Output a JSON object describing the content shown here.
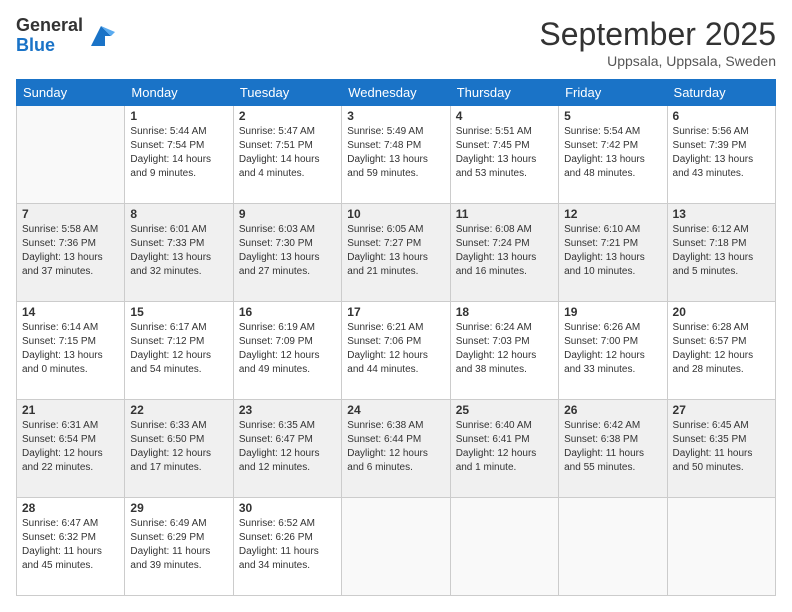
{
  "logo": {
    "general": "General",
    "blue": "Blue"
  },
  "title": "September 2025",
  "location": "Uppsala, Uppsala, Sweden",
  "weekdays": [
    "Sunday",
    "Monday",
    "Tuesday",
    "Wednesday",
    "Thursday",
    "Friday",
    "Saturday"
  ],
  "weeks": [
    [
      {
        "day": "",
        "info": ""
      },
      {
        "day": "1",
        "info": "Sunrise: 5:44 AM\nSunset: 7:54 PM\nDaylight: 14 hours\nand 9 minutes."
      },
      {
        "day": "2",
        "info": "Sunrise: 5:47 AM\nSunset: 7:51 PM\nDaylight: 14 hours\nand 4 minutes."
      },
      {
        "day": "3",
        "info": "Sunrise: 5:49 AM\nSunset: 7:48 PM\nDaylight: 13 hours\nand 59 minutes."
      },
      {
        "day": "4",
        "info": "Sunrise: 5:51 AM\nSunset: 7:45 PM\nDaylight: 13 hours\nand 53 minutes."
      },
      {
        "day": "5",
        "info": "Sunrise: 5:54 AM\nSunset: 7:42 PM\nDaylight: 13 hours\nand 48 minutes."
      },
      {
        "day": "6",
        "info": "Sunrise: 5:56 AM\nSunset: 7:39 PM\nDaylight: 13 hours\nand 43 minutes."
      }
    ],
    [
      {
        "day": "7",
        "info": "Sunrise: 5:58 AM\nSunset: 7:36 PM\nDaylight: 13 hours\nand 37 minutes."
      },
      {
        "day": "8",
        "info": "Sunrise: 6:01 AM\nSunset: 7:33 PM\nDaylight: 13 hours\nand 32 minutes."
      },
      {
        "day": "9",
        "info": "Sunrise: 6:03 AM\nSunset: 7:30 PM\nDaylight: 13 hours\nand 27 minutes."
      },
      {
        "day": "10",
        "info": "Sunrise: 6:05 AM\nSunset: 7:27 PM\nDaylight: 13 hours\nand 21 minutes."
      },
      {
        "day": "11",
        "info": "Sunrise: 6:08 AM\nSunset: 7:24 PM\nDaylight: 13 hours\nand 16 minutes."
      },
      {
        "day": "12",
        "info": "Sunrise: 6:10 AM\nSunset: 7:21 PM\nDaylight: 13 hours\nand 10 minutes."
      },
      {
        "day": "13",
        "info": "Sunrise: 6:12 AM\nSunset: 7:18 PM\nDaylight: 13 hours\nand 5 minutes."
      }
    ],
    [
      {
        "day": "14",
        "info": "Sunrise: 6:14 AM\nSunset: 7:15 PM\nDaylight: 13 hours\nand 0 minutes."
      },
      {
        "day": "15",
        "info": "Sunrise: 6:17 AM\nSunset: 7:12 PM\nDaylight: 12 hours\nand 54 minutes."
      },
      {
        "day": "16",
        "info": "Sunrise: 6:19 AM\nSunset: 7:09 PM\nDaylight: 12 hours\nand 49 minutes."
      },
      {
        "day": "17",
        "info": "Sunrise: 6:21 AM\nSunset: 7:06 PM\nDaylight: 12 hours\nand 44 minutes."
      },
      {
        "day": "18",
        "info": "Sunrise: 6:24 AM\nSunset: 7:03 PM\nDaylight: 12 hours\nand 38 minutes."
      },
      {
        "day": "19",
        "info": "Sunrise: 6:26 AM\nSunset: 7:00 PM\nDaylight: 12 hours\nand 33 minutes."
      },
      {
        "day": "20",
        "info": "Sunrise: 6:28 AM\nSunset: 6:57 PM\nDaylight: 12 hours\nand 28 minutes."
      }
    ],
    [
      {
        "day": "21",
        "info": "Sunrise: 6:31 AM\nSunset: 6:54 PM\nDaylight: 12 hours\nand 22 minutes."
      },
      {
        "day": "22",
        "info": "Sunrise: 6:33 AM\nSunset: 6:50 PM\nDaylight: 12 hours\nand 17 minutes."
      },
      {
        "day": "23",
        "info": "Sunrise: 6:35 AM\nSunset: 6:47 PM\nDaylight: 12 hours\nand 12 minutes."
      },
      {
        "day": "24",
        "info": "Sunrise: 6:38 AM\nSunset: 6:44 PM\nDaylight: 12 hours\nand 6 minutes."
      },
      {
        "day": "25",
        "info": "Sunrise: 6:40 AM\nSunset: 6:41 PM\nDaylight: 12 hours\nand 1 minute."
      },
      {
        "day": "26",
        "info": "Sunrise: 6:42 AM\nSunset: 6:38 PM\nDaylight: 11 hours\nand 55 minutes."
      },
      {
        "day": "27",
        "info": "Sunrise: 6:45 AM\nSunset: 6:35 PM\nDaylight: 11 hours\nand 50 minutes."
      }
    ],
    [
      {
        "day": "28",
        "info": "Sunrise: 6:47 AM\nSunset: 6:32 PM\nDaylight: 11 hours\nand 45 minutes."
      },
      {
        "day": "29",
        "info": "Sunrise: 6:49 AM\nSunset: 6:29 PM\nDaylight: 11 hours\nand 39 minutes."
      },
      {
        "day": "30",
        "info": "Sunrise: 6:52 AM\nSunset: 6:26 PM\nDaylight: 11 hours\nand 34 minutes."
      },
      {
        "day": "",
        "info": ""
      },
      {
        "day": "",
        "info": ""
      },
      {
        "day": "",
        "info": ""
      },
      {
        "day": "",
        "info": ""
      }
    ]
  ]
}
